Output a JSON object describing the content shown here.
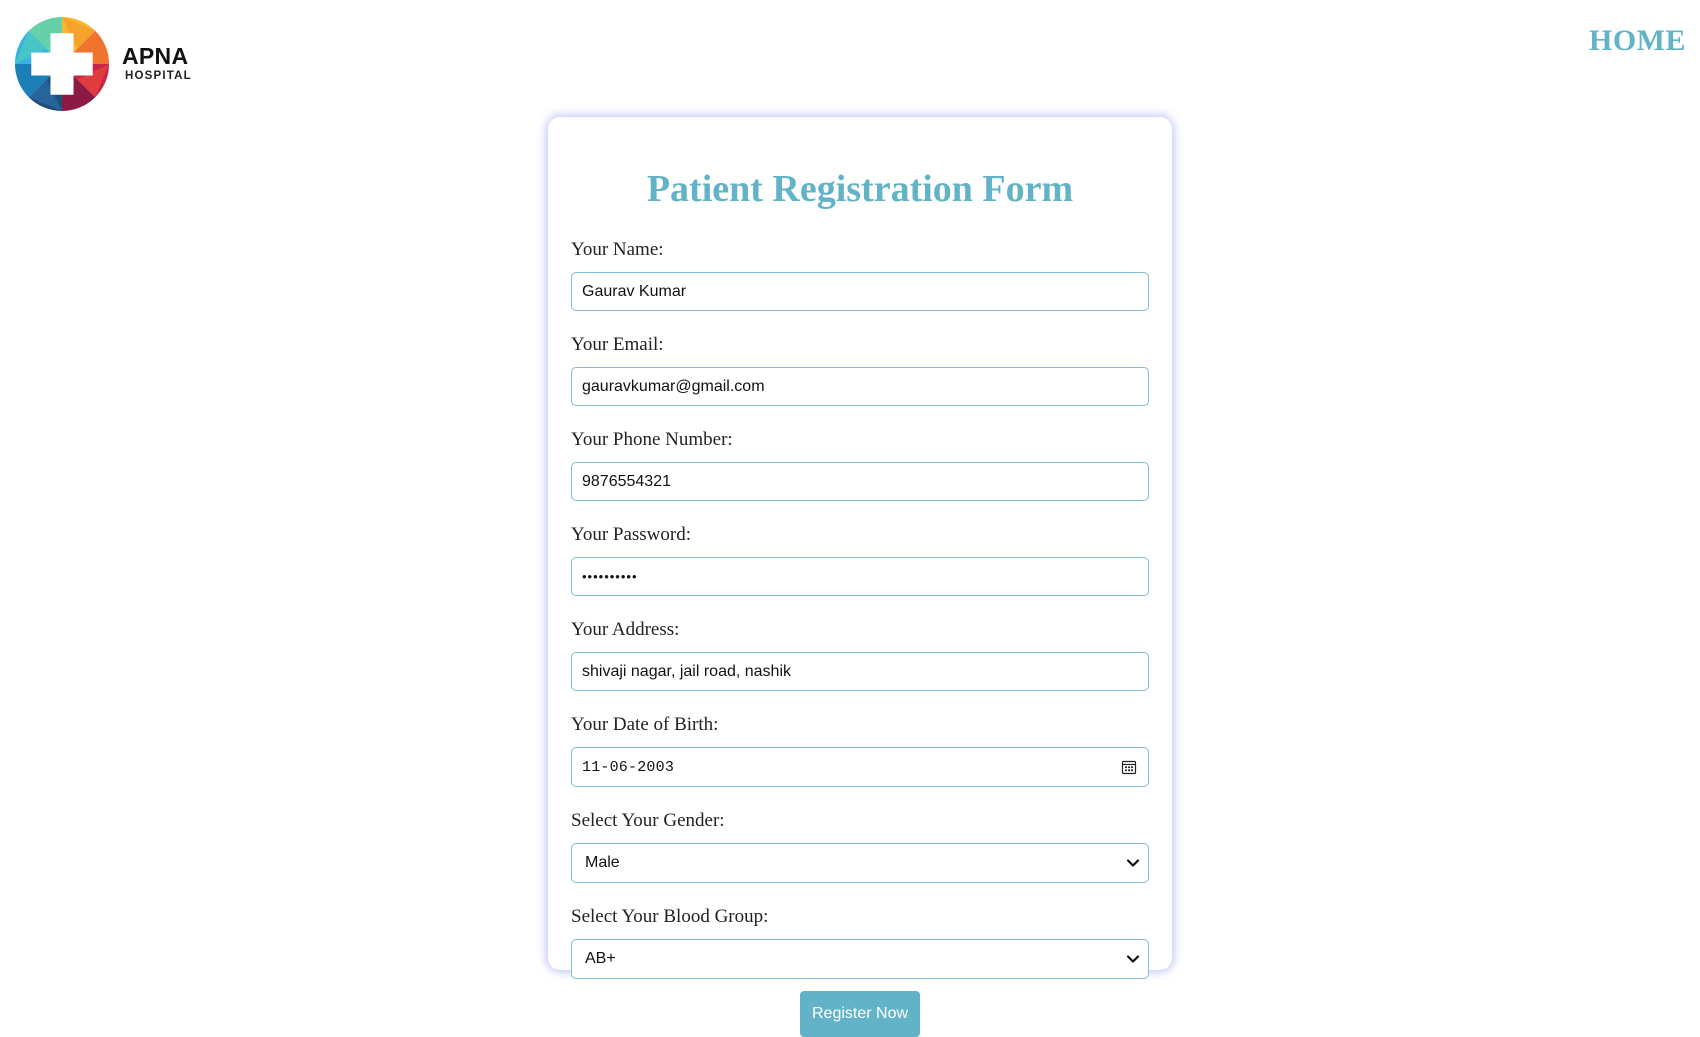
{
  "brand": {
    "name": "APNA",
    "subtitle": "HOSPITAL",
    "logo_colors": [
      "#f7b731",
      "#f0742e",
      "#e4423b",
      "#c8234c",
      "#8c1a45",
      "#1f4d7a",
      "#1d7fb8",
      "#36b3e0",
      "#4cc9c0",
      "#66d0a8"
    ]
  },
  "nav": {
    "home_label": "HOME"
  },
  "form": {
    "title": "Patient Registration Form",
    "fields": {
      "name": {
        "label": "Your Name:",
        "value": "Gaurav Kumar"
      },
      "email": {
        "label": "Your Email:",
        "value": "gauravkumar@gmail.com"
      },
      "phone": {
        "label": "Your Phone Number:",
        "value": "9876554321"
      },
      "password": {
        "label": "Your Password:",
        "value": "••••••••••"
      },
      "address": {
        "label": "Your Address:",
        "value": "shivaji nagar, jail road, nashik"
      },
      "dob": {
        "label": "Your Date of Birth:",
        "value": "11-06-2003",
        "icon": "calendar-icon"
      },
      "gender": {
        "label": "Select Your Gender:",
        "selected": "Male",
        "icon": "chevron-down-icon"
      },
      "blood_group": {
        "label": "Select Your Blood Group:",
        "selected": "AB+",
        "icon": "chevron-down-icon"
      }
    },
    "submit_label": "Register Now"
  },
  "colors": {
    "accent": "#62b3c8",
    "input_border": "#7fc1d3",
    "card_shadow": "#8c96f0"
  }
}
